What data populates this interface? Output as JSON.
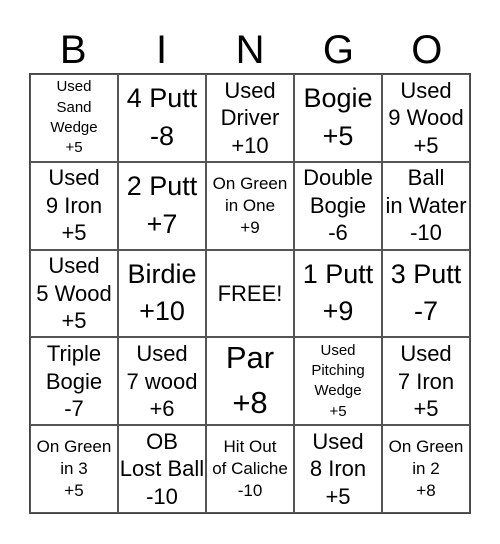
{
  "header": [
    "B",
    "I",
    "N",
    "G",
    "O"
  ],
  "cells": [
    {
      "text": "Used\nSand\nWedge\n+5",
      "size": "s-sm"
    },
    {
      "text": "4 Putt\n-8",
      "size": "s-xl"
    },
    {
      "text": "Used\nDriver\n+10",
      "size": "s-lg"
    },
    {
      "text": "Bogie\n+5",
      "size": "s-xl"
    },
    {
      "text": "Used\n9 Wood\n+5",
      "size": "s-lg"
    },
    {
      "text": "Used\n9 Iron\n+5",
      "size": "s-lg"
    },
    {
      "text": "2 Putt\n+7",
      "size": "s-xl"
    },
    {
      "text": "On Green\nin One\n+9",
      "size": "s-md"
    },
    {
      "text": "Double\nBogie\n-6",
      "size": "s-lg"
    },
    {
      "text": "Ball\nin Water\n-10",
      "size": "s-lg"
    },
    {
      "text": "Used\n5 Wood\n+5",
      "size": "s-lg"
    },
    {
      "text": "Birdie\n+10",
      "size": "s-xl"
    },
    {
      "text": "FREE!",
      "size": "s-lg"
    },
    {
      "text": "1 Putt\n+9",
      "size": "s-xl"
    },
    {
      "text": "3 Putt\n-7",
      "size": "s-xl"
    },
    {
      "text": "Triple\nBogie\n-7",
      "size": "s-lg"
    },
    {
      "text": "Used\n7 wood\n+6",
      "size": "s-lg"
    },
    {
      "text": "Par\n+8",
      "size": "s-xxl"
    },
    {
      "text": "Used\nPitching\nWedge\n+5",
      "size": "s-sm"
    },
    {
      "text": "Used\n7 Iron\n+5",
      "size": "s-lg"
    },
    {
      "text": "On Green\nin 3\n+5",
      "size": "s-md"
    },
    {
      "text": "OB\nLost Ball\n-10",
      "size": "s-lg"
    },
    {
      "text": "Hit Out\nof Caliche\n-10",
      "size": "s-md"
    },
    {
      "text": "Used\n8 Iron\n+5",
      "size": "s-lg"
    },
    {
      "text": "On Green\nin 2\n+8",
      "size": "s-md"
    }
  ]
}
